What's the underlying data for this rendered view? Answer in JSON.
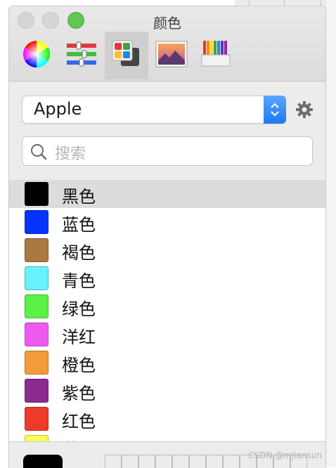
{
  "window": {
    "title": "颜色",
    "traffic_lights": [
      "close-button-inactive",
      "minimize-button-inactive",
      "zoom-button"
    ]
  },
  "toolbar": {
    "tools": [
      {
        "name": "color-wheel-icon",
        "selected": false
      },
      {
        "name": "color-sliders-icon",
        "selected": false
      },
      {
        "name": "color-palettes-icon",
        "selected": true
      },
      {
        "name": "image-palettes-icon",
        "selected": false
      },
      {
        "name": "pencils-icon",
        "selected": false
      }
    ]
  },
  "palette": {
    "selected_value": "Apple",
    "gear_icon": "gear-icon"
  },
  "search": {
    "placeholder": "搜索",
    "icon": "search-icon"
  },
  "colors": [
    {
      "label": "黑色",
      "hex": "#000000",
      "selected": true
    },
    {
      "label": "蓝色",
      "hex": "#0433ff",
      "selected": false
    },
    {
      "label": "褐色",
      "hex": "#aa7942",
      "selected": false
    },
    {
      "label": "青色",
      "hex": "#66f3ff",
      "selected": false
    },
    {
      "label": "绿色",
      "hex": "#5af246",
      "selected": false
    },
    {
      "label": "洋红",
      "hex": "#ee5af0",
      "selected": false
    },
    {
      "label": "橙色",
      "hex": "#f49a3a",
      "selected": false
    },
    {
      "label": "紫色",
      "hex": "#8b2b8f",
      "selected": false
    },
    {
      "label": "红色",
      "hex": "#ee3a28",
      "selected": false
    },
    {
      "label": "黄色",
      "hex": "#fefb55",
      "selected": false
    }
  ],
  "current_color": {
    "hex": "#000000"
  },
  "watermark": "CSDN @mjiansun",
  "accent": "#1f79f2"
}
